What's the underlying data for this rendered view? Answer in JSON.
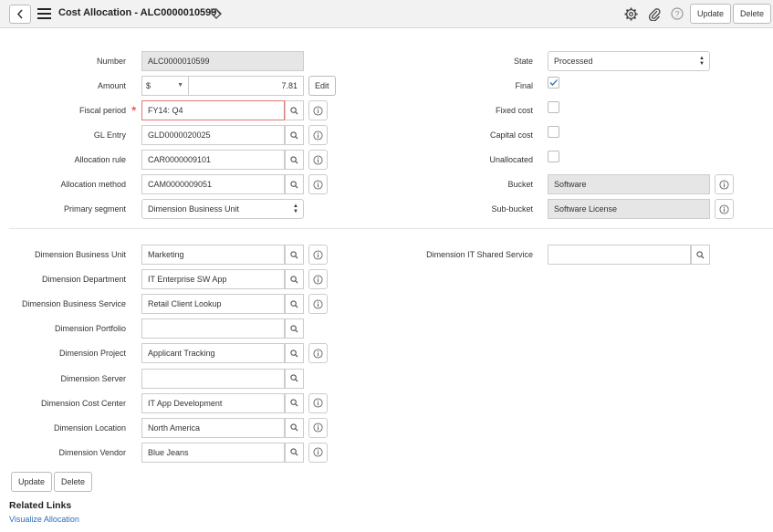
{
  "header": {
    "title": "Cost Allocation - ALC0000010599",
    "update_label": "Update",
    "delete_label": "Delete"
  },
  "left_fields": {
    "number": {
      "label": "Number",
      "value": "ALC0000010599"
    },
    "amount": {
      "label": "Amount",
      "currency": "$",
      "value": "7.81",
      "edit_label": "Edit"
    },
    "fiscal_period": {
      "label": "Fiscal period",
      "value": "FY14: Q4"
    },
    "gl_entry": {
      "label": "GL Entry",
      "value": "GLD0000020025"
    },
    "allocation_rule": {
      "label": "Allocation rule",
      "value": "CAR0000009101"
    },
    "allocation_method": {
      "label": "Allocation method",
      "value": "CAM0000009051"
    },
    "primary_segment": {
      "label": "Primary segment",
      "value": "Dimension Business Unit"
    }
  },
  "right_fields": {
    "state": {
      "label": "State",
      "value": "Processed"
    },
    "final": {
      "label": "Final",
      "checked": true
    },
    "fixed_cost": {
      "label": "Fixed cost",
      "checked": false
    },
    "capital_cost": {
      "label": "Capital cost",
      "checked": false
    },
    "unallocated": {
      "label": "Unallocated",
      "checked": false
    },
    "bucket": {
      "label": "Bucket",
      "value": "Software"
    },
    "sub_bucket": {
      "label": "Sub-bucket",
      "value": "Software License"
    }
  },
  "dimensions": [
    {
      "label": "Dimension Business Unit",
      "value": "Marketing",
      "info": true
    },
    {
      "label": "Dimension Department",
      "value": "IT Enterprise SW App",
      "info": true
    },
    {
      "label": "Dimension Business Service",
      "value": "Retail Client Lookup",
      "info": true
    },
    {
      "label": "Dimension Portfolio",
      "value": "",
      "info": false
    },
    {
      "label": "Dimension Project",
      "value": "Applicant Tracking",
      "info": true
    },
    {
      "label": "Dimension Server",
      "value": "",
      "info": false
    },
    {
      "label": "Dimension Cost Center",
      "value": "IT App Development",
      "info": true
    },
    {
      "label": "Dimension Location",
      "value": "North America",
      "info": true
    },
    {
      "label": "Dimension Vendor",
      "value": "Blue Jeans",
      "info": true
    }
  ],
  "it_shared_service": {
    "label": "Dimension IT Shared Service",
    "value": ""
  },
  "footer": {
    "update_label": "Update",
    "delete_label": "Delete",
    "related_links_title": "Related Links",
    "visualize_link": "Visualize Allocation"
  },
  "colors": {
    "accent_check": "#2a6ebb",
    "mandatory": "#e03030",
    "link": "#2a6ebb"
  }
}
